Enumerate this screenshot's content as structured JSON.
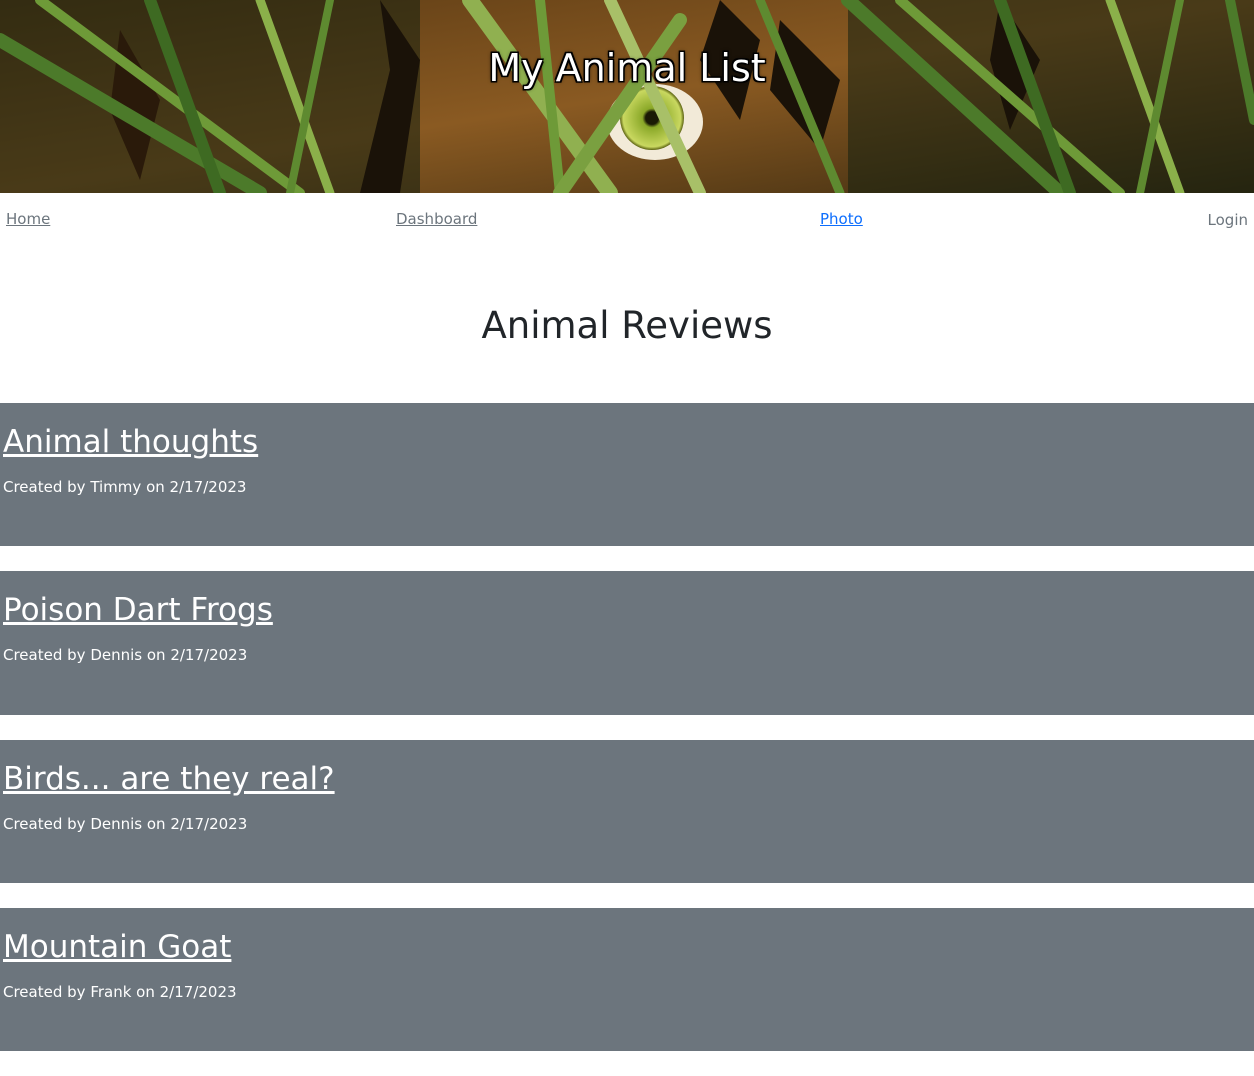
{
  "header": {
    "title": "My Animal List"
  },
  "nav": {
    "home": "Home",
    "dashboard": "Dashboard",
    "photo": "Photo",
    "login": "Login"
  },
  "main": {
    "heading": "Animal Reviews",
    "reviews": [
      {
        "title": "Animal thoughts",
        "created_prefix": "Created by ",
        "author": "Timmy",
        "on": " on ",
        "date": "2/17/2023"
      },
      {
        "title": "Poison Dart Frogs",
        "created_prefix": "Created by ",
        "author": "Dennis",
        "on": " on ",
        "date": "2/17/2023"
      },
      {
        "title": "Birds... are they real?",
        "created_prefix": "Created by ",
        "author": "Dennis",
        "on": " on ",
        "date": "2/17/2023"
      },
      {
        "title": "Mountain Goat",
        "created_prefix": "Created by ",
        "author": "Frank",
        "on": " on ",
        "date": "2/17/2023"
      }
    ]
  },
  "colors": {
    "card_background": "#6c757d",
    "link_primary": "#0d6efd",
    "link_muted": "#6c757d",
    "heading_text": "#212529"
  }
}
